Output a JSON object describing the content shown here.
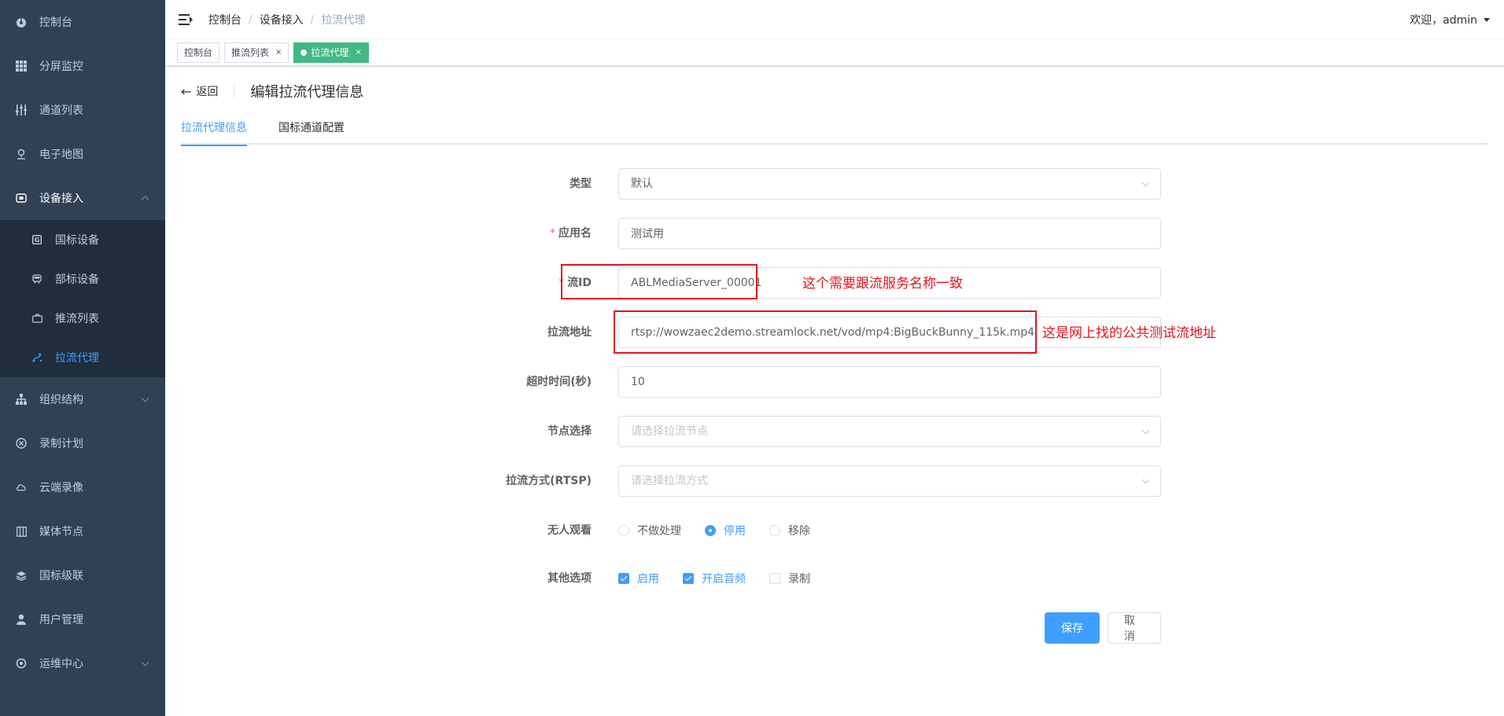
{
  "sidebar": {
    "items": [
      {
        "label": "控制台",
        "icon": "dashboard-icon"
      },
      {
        "label": "分屏监控",
        "icon": "grid-icon"
      },
      {
        "label": "通道列表",
        "icon": "sliders-icon"
      },
      {
        "label": "电子地图",
        "icon": "map-pin-icon"
      },
      {
        "label": "设备接入",
        "icon": "device-icon",
        "expanded": true
      }
    ],
    "subitems": [
      {
        "label": "国标设备",
        "icon": "gb-device-icon"
      },
      {
        "label": "部标设备",
        "icon": "bus-icon"
      },
      {
        "label": "推流列表",
        "icon": "camera-icon"
      },
      {
        "label": "拉流代理",
        "icon": "pull-proxy-icon",
        "active": true
      }
    ],
    "items_after": [
      {
        "label": "组织结构",
        "icon": "org-tree-icon",
        "has_arrow": true
      },
      {
        "label": "录制计划",
        "icon": "record-plan-icon"
      },
      {
        "label": "云端录像",
        "icon": "cloud-icon"
      },
      {
        "label": "媒体节点",
        "icon": "media-node-icon"
      },
      {
        "label": "国标级联",
        "icon": "layers-icon"
      },
      {
        "label": "用户管理",
        "icon": "user-icon"
      },
      {
        "label": "运维中心",
        "icon": "ops-icon",
        "has_arrow": true
      }
    ]
  },
  "navbar": {
    "breadcrumb": [
      "控制台",
      "设备接入",
      "拉流代理"
    ],
    "sep": "/",
    "user_text": "欢迎，admin"
  },
  "tags": [
    {
      "label": "控制台",
      "active": false,
      "closable": false
    },
    {
      "label": "推流列表",
      "active": false,
      "closable": true
    },
    {
      "label": "拉流代理",
      "active": true,
      "closable": true
    }
  ],
  "tag_close": "×",
  "page_header": {
    "back_icon": "←",
    "back": "返回",
    "title": "编辑拉流代理信息"
  },
  "tabs": [
    "拉流代理信息",
    "国标通道配置"
  ],
  "form": {
    "type_label": "类型",
    "type_value": "默认",
    "app_label": "应用名",
    "app_value": "测试用",
    "stream_label": "流ID",
    "stream_value": "ABLMediaServer_00001",
    "url_label": "拉流地址",
    "url_value": "rtsp://wowzaec2demo.streamlock.net/vod/mp4:BigBuckBunny_115k.mp4",
    "timeout_label": "超时时间(秒)",
    "timeout_value": "10",
    "node_label": "节点选择",
    "node_placeholder": "请选择拉流节点",
    "rtsp_label": "拉流方式(RTSP)",
    "rtsp_placeholder": "请选择拉流方式",
    "noone_label": "无人观看",
    "noone_options": [
      "不做处理",
      "停用",
      "移除"
    ],
    "noone_selected": 1,
    "other_label": "其他选项",
    "other_options": [
      {
        "label": "启用",
        "checked": true
      },
      {
        "label": "开启音频",
        "checked": true
      },
      {
        "label": "录制",
        "checked": false
      }
    ],
    "required_mark": "*"
  },
  "buttons": {
    "save": "保存",
    "cancel": "取消"
  },
  "annotations": {
    "stream_note": "这个需要跟流服务名称一致",
    "url_note": "这是网上找的公共测试流地址"
  },
  "colors": {
    "sidebar_bg": "#304156",
    "active": "#409eff",
    "tag_active": "#42b983",
    "annotation": "#e5131d"
  }
}
